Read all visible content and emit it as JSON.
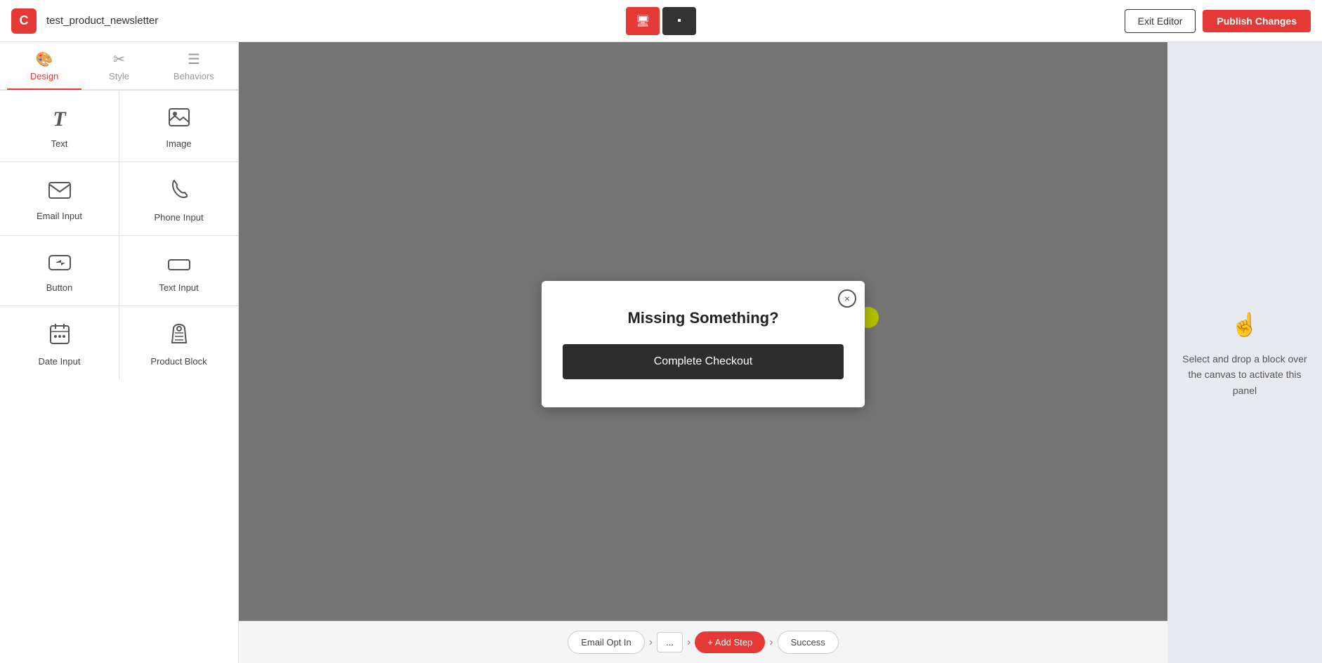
{
  "header": {
    "logo_letter": "C",
    "title": "test_product_newsletter",
    "exit_label": "Exit Editor",
    "publish_label": "Publish Changes",
    "view_desktop_icon": "🖥",
    "view_mobile_icon": "▪"
  },
  "sidebar": {
    "tabs": [
      {
        "id": "design",
        "label": "Design",
        "icon": "🎨",
        "active": true
      },
      {
        "id": "style",
        "label": "Style",
        "icon": "✂",
        "active": false
      },
      {
        "id": "behaviors",
        "label": "Behaviors",
        "icon": "☰",
        "active": false
      }
    ],
    "blocks": [
      {
        "id": "text",
        "label": "Text",
        "icon": "T"
      },
      {
        "id": "image",
        "label": "Image",
        "icon": "🖼"
      },
      {
        "id": "email-input",
        "label": "Email Input",
        "icon": "✉"
      },
      {
        "id": "phone-input",
        "label": "Phone Input",
        "icon": "📞"
      },
      {
        "id": "button",
        "label": "Button",
        "icon": "👆"
      },
      {
        "id": "text-input",
        "label": "Text Input",
        "icon": "▭"
      },
      {
        "id": "date-input",
        "label": "Date Input",
        "icon": "📅"
      },
      {
        "id": "product-block",
        "label": "Product Block",
        "icon": "👕"
      }
    ]
  },
  "canvas": {
    "modal": {
      "title": "Missing Something?",
      "checkout_label": "Complete Checkout",
      "close_icon": "×"
    }
  },
  "step_bar": {
    "steps": [
      {
        "label": "Email Opt In",
        "active": false
      },
      {
        "label": "...",
        "active": false
      },
      {
        "label": "+ Add Step",
        "active": true
      },
      {
        "label": "Success",
        "active": false
      }
    ]
  },
  "right_panel": {
    "icon": "👆",
    "text": "Select and drop a block over the canvas to activate this panel"
  }
}
